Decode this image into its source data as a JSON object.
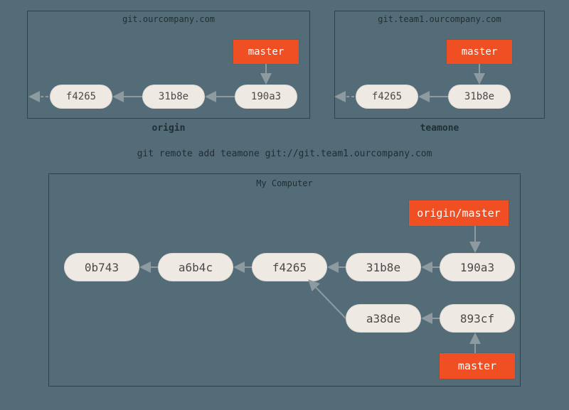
{
  "remotes": {
    "origin": {
      "host": "git.ourcompany.com",
      "label": "origin",
      "branch": "master",
      "commits": [
        "f4265",
        "31b8e",
        "190a3"
      ]
    },
    "teamone": {
      "host": "git.team1.ourcompany.com",
      "label": "teamone",
      "branch": "master",
      "commits": [
        "f4265",
        "31b8e"
      ]
    }
  },
  "command": "git remote add teamone git://git.team1.ourcompany.com",
  "local": {
    "label": "My Computer",
    "tracking_branch": "origin/master",
    "local_branch": "master",
    "commits_row1": [
      "0b743",
      "a6b4c",
      "f4265",
      "31b8e",
      "190a3"
    ],
    "commits_row2": [
      "a38de",
      "893cf"
    ]
  }
}
